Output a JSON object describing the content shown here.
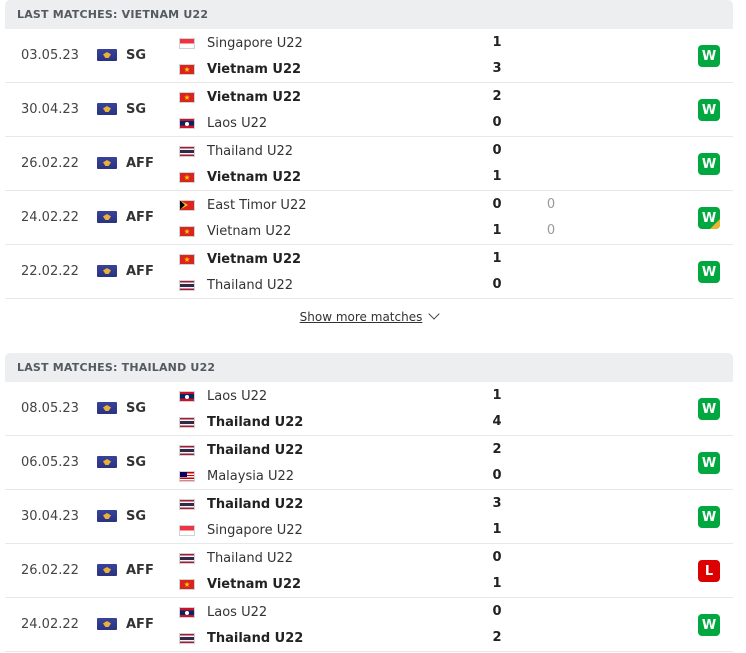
{
  "sections": [
    {
      "title": "LAST MATCHES: VIETNAM U22",
      "matches": [
        {
          "date": "03.05.23",
          "competition": "SG",
          "home": {
            "name": "Singapore U22",
            "flag": "sg",
            "bold": false
          },
          "home_score": "1",
          "away": {
            "name": "Vietnam U22",
            "flag": "vn",
            "bold": true
          },
          "away_score": "3",
          "result": "W",
          "result_type": "win"
        },
        {
          "date": "30.04.23",
          "competition": "SG",
          "home": {
            "name": "Vietnam U22",
            "flag": "vn",
            "bold": true
          },
          "home_score": "2",
          "away": {
            "name": "Laos U22",
            "flag": "la",
            "bold": false
          },
          "away_score": "0",
          "result": "W",
          "result_type": "win"
        },
        {
          "date": "26.02.22",
          "competition": "AFF",
          "home": {
            "name": "Thailand U22",
            "flag": "th",
            "bold": false
          },
          "home_score": "0",
          "away": {
            "name": "Vietnam U22",
            "flag": "vn",
            "bold": true
          },
          "away_score": "1",
          "result": "W",
          "result_type": "win"
        },
        {
          "date": "24.02.22",
          "competition": "AFF",
          "home": {
            "name": "East Timor U22",
            "flag": "tl",
            "bold": false
          },
          "home_score": "0",
          "home_pen": "0",
          "away": {
            "name": "Vietnam U22",
            "flag": "vn",
            "bold": false
          },
          "away_score": "1",
          "away_pen": "0",
          "result": "W",
          "result_type": "win-pen"
        },
        {
          "date": "22.02.22",
          "competition": "AFF",
          "home": {
            "name": "Vietnam U22",
            "flag": "vn",
            "bold": true
          },
          "home_score": "1",
          "away": {
            "name": "Thailand U22",
            "flag": "th",
            "bold": false
          },
          "away_score": "0",
          "result": "W",
          "result_type": "win"
        }
      ]
    },
    {
      "title": "LAST MATCHES: THAILAND U22",
      "matches": [
        {
          "date": "08.05.23",
          "competition": "SG",
          "home": {
            "name": "Laos U22",
            "flag": "la",
            "bold": false
          },
          "home_score": "1",
          "away": {
            "name": "Thailand U22",
            "flag": "th",
            "bold": true
          },
          "away_score": "4",
          "result": "W",
          "result_type": "win"
        },
        {
          "date": "06.05.23",
          "competition": "SG",
          "home": {
            "name": "Thailand U22",
            "flag": "th",
            "bold": true
          },
          "home_score": "2",
          "away": {
            "name": "Malaysia U22",
            "flag": "my",
            "bold": false
          },
          "away_score": "0",
          "result": "W",
          "result_type": "win"
        },
        {
          "date": "30.04.23",
          "competition": "SG",
          "home": {
            "name": "Thailand U22",
            "flag": "th",
            "bold": true
          },
          "home_score": "3",
          "away": {
            "name": "Singapore U22",
            "flag": "sg",
            "bold": false
          },
          "away_score": "1",
          "result": "W",
          "result_type": "win"
        },
        {
          "date": "26.02.22",
          "competition": "AFF",
          "home": {
            "name": "Thailand U22",
            "flag": "th",
            "bold": false
          },
          "home_score": "0",
          "away": {
            "name": "Vietnam U22",
            "flag": "vn",
            "bold": true
          },
          "away_score": "1",
          "result": "L",
          "result_type": "lose"
        },
        {
          "date": "24.02.22",
          "competition": "AFF",
          "home": {
            "name": "Laos U22",
            "flag": "la",
            "bold": false
          },
          "home_score": "0",
          "away": {
            "name": "Thailand U22",
            "flag": "th",
            "bold": true
          },
          "away_score": "2",
          "result": "W",
          "result_type": "win"
        }
      ]
    }
  ],
  "show_more_label": "Show more matches",
  "colors": {
    "win": "#00a83f",
    "lose": "#dc0000",
    "header_bg": "#eceef0",
    "penalty_marker": "#f0b431"
  }
}
